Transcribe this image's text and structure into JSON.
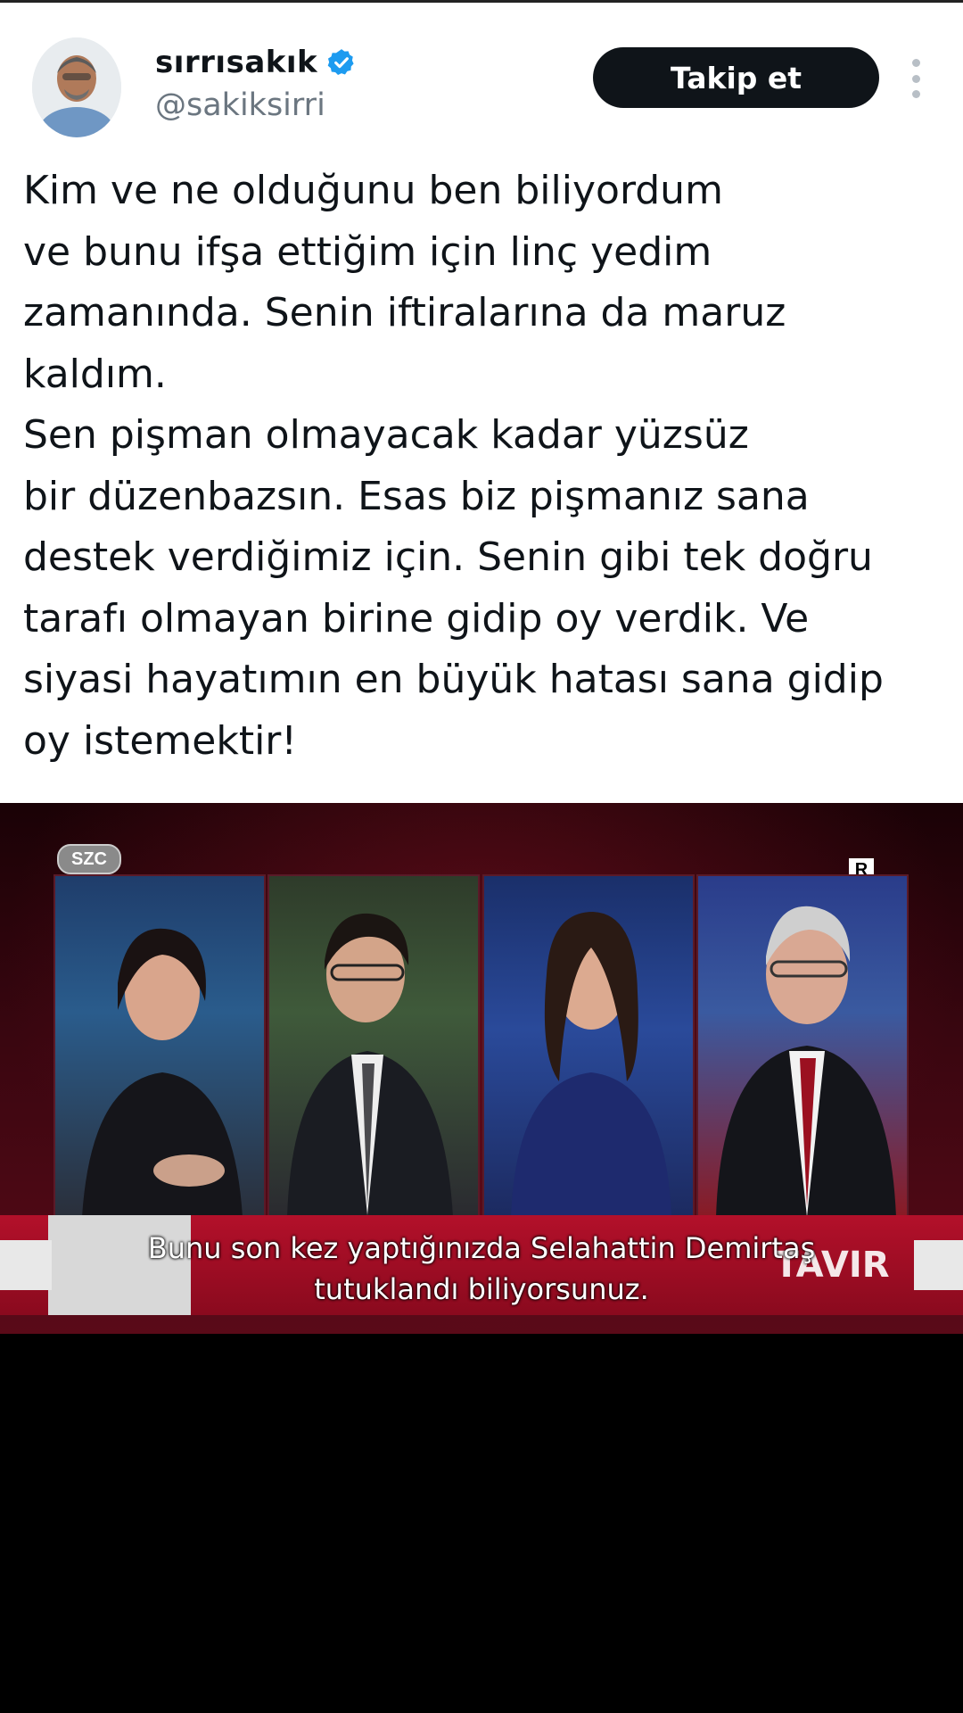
{
  "tweet": {
    "display_name": "sırrısakık",
    "handle": "@sakiksirri",
    "follow_label": "Takip et",
    "lines": [
      "Kim ve ne olduğunu ben biliyordum",
      "ve bunu ifşa ettiğim için linç yedim",
      "zamanında. Senin iftiralarına da maruz",
      "kaldım.",
      "Sen pişman olmayacak kadar yüzsüz",
      "bir düzenbazsın. Esas biz pişmanız sana",
      "destek verdiğimiz için. Senin gibi tek doğru",
      "tarafı olmayan birine gidip oy verdik. Ve",
      "siyasi hayatımın en büyük hatası sana gidip",
      "oy istemektir!"
    ]
  },
  "video": {
    "channel_logo": "SZC",
    "rating_badge": "R",
    "show_logo": "TAVIR",
    "subtitle_lines": [
      "Bunu son kez yaptığınızda Selahattin Demirtaş",
      "tutuklandı biliyorsunuz."
    ]
  },
  "colors": {
    "verified_blue": "#1d9bf0",
    "follow_bg": "#0f1419",
    "text": "#0f1419",
    "handle_gray": "#6b7680",
    "broadcast_red": "#b3102a"
  },
  "icons": {
    "verified": "verified-badge-icon",
    "more": "more-vertical-icon"
  }
}
